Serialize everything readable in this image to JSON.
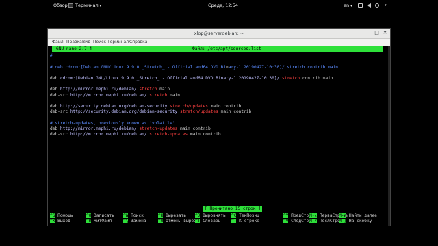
{
  "topbar": {
    "activities": "Обзор",
    "app_menu": "Терминал",
    "clock": "Среда, 12:54",
    "lang": "en"
  },
  "window": {
    "title": "xlop@serverdebian: ~",
    "menu": [
      "Файл",
      "Правка",
      "Вид",
      "Поиск",
      "Терминал",
      "Справка"
    ]
  },
  "nano": {
    "version": "GNU nano 2.7.4",
    "file": "Файл: /etc/apt/sources.list",
    "status": "[ Прочитано 15 строк ]"
  },
  "lines": [
    {
      "row": 1,
      "parts": [
        {
          "t": "#",
          "c": "comment"
        }
      ]
    },
    {
      "row": 3,
      "parts": [
        {
          "t": "# deb cdrom:[Debian GNU/Linux 9.9.0 _Stretch_ - Official amd64 DVD Bi",
          "c": "comment"
        },
        {
          "t": "n",
          "c": "cursor"
        },
        {
          "t": "ary-1 20190427-10:30]/ stretch contrib main",
          "c": "comment"
        }
      ]
    },
    {
      "row": 5,
      "parts": [
        {
          "t": "deb ",
          "c": "kw"
        },
        {
          "t": "cdrom:[Debian GNU/Linux 9.9.0 _Stretch_ - Official amd64 DVD Binary-1 20190427-10:30]/ ",
          "c": "url"
        },
        {
          "t": "stretch ",
          "c": "dist"
        },
        {
          "t": "contrib main",
          "c": "comp"
        }
      ]
    },
    {
      "row": 7,
      "parts": [
        {
          "t": "deb ",
          "c": "kw"
        },
        {
          "t": "http://mirror.mephi.ru/debian/ ",
          "c": "url"
        },
        {
          "t": "stretch ",
          "c": "dist"
        },
        {
          "t": "main",
          "c": "comp"
        }
      ]
    },
    {
      "row": 8,
      "parts": [
        {
          "t": "deb-src ",
          "c": "kw"
        },
        {
          "t": "http://mirror.mephi.ru/debian/ ",
          "c": "url"
        },
        {
          "t": "stretch ",
          "c": "dist"
        },
        {
          "t": "main",
          "c": "comp"
        }
      ]
    },
    {
      "row": 10,
      "parts": [
        {
          "t": "deb ",
          "c": "kw"
        },
        {
          "t": "http://security.debian.org/debian-security ",
          "c": "url"
        },
        {
          "t": "stretch/updates ",
          "c": "dist"
        },
        {
          "t": "main contrib",
          "c": "comp"
        }
      ]
    },
    {
      "row": 11,
      "parts": [
        {
          "t": "deb-src ",
          "c": "kw"
        },
        {
          "t": "http://security.debian.org/debian-security ",
          "c": "url"
        },
        {
          "t": "stretch/updates ",
          "c": "dist"
        },
        {
          "t": "main contrib",
          "c": "comp"
        }
      ]
    },
    {
      "row": 13,
      "parts": [
        {
          "t": "# stretch-updates, previously known as 'volatile'",
          "c": "comment"
        }
      ]
    },
    {
      "row": 14,
      "parts": [
        {
          "t": "deb ",
          "c": "kw"
        },
        {
          "t": "http://mirror.mephi.ru/debian/ ",
          "c": "url"
        },
        {
          "t": "stretch-updates ",
          "c": "dist"
        },
        {
          "t": "main contrib",
          "c": "comp"
        }
      ]
    },
    {
      "row": 15,
      "parts": [
        {
          "t": "deb-src ",
          "c": "kw"
        },
        {
          "t": "http://mirror.mephi.ru/debian/ ",
          "c": "url"
        },
        {
          "t": "stretch-updates ",
          "c": "dist"
        },
        {
          "t": "main contrib",
          "c": "comp"
        }
      ]
    }
  ],
  "shortcuts": [
    [
      {
        "key": "^G",
        "label": "Помощь"
      },
      {
        "key": "^X",
        "label": "Выход"
      }
    ],
    [
      {
        "key": "^O",
        "label": "Записать"
      },
      {
        "key": "^R",
        "label": "ЧитФайл"
      }
    ],
    [
      {
        "key": "^W",
        "label": "Поиск"
      },
      {
        "key": "^\\",
        "label": "Замена"
      }
    ],
    [
      {
        "key": "^K",
        "label": "Вырезать"
      },
      {
        "key": "^U",
        "label": "Отмен. вырез"
      }
    ],
    [
      {
        "key": "^J",
        "label": "Выровнять"
      },
      {
        "key": "^T",
        "label": "Словарь"
      }
    ],
    [
      {
        "key": "^C",
        "label": "ТекПозиц"
      },
      {
        "key": "^_",
        "label": "К строке"
      }
    ],
    [
      {
        "key": "^Y",
        "label": "ПредСтр"
      },
      {
        "key": "^V",
        "label": "СледСтр"
      }
    ],
    [
      {
        "key": "M-\\",
        "label": "ПерваСтрока"
      },
      {
        "key": "M-/",
        "label": "ПослСтрока"
      }
    ],
    [
      {
        "key": "M-W",
        "label": "Найти далее"
      },
      {
        "key": "M-]",
        "label": "На скобку"
      }
    ]
  ]
}
